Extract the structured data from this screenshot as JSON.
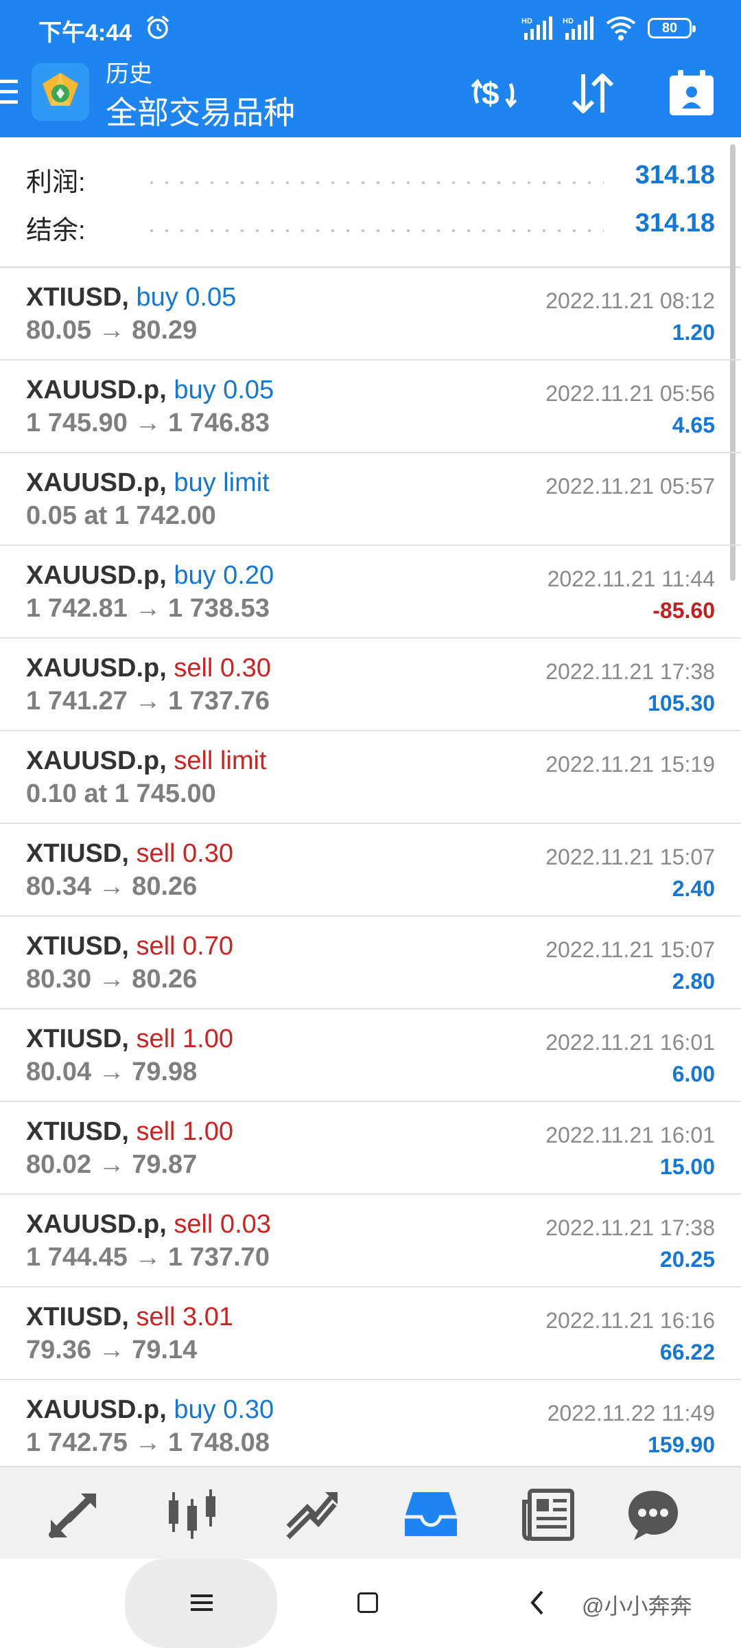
{
  "status_bar": {
    "time": "下午4:44",
    "net1": "HD",
    "net2": "HD",
    "battery": "80"
  },
  "header": {
    "subtitle": "历史",
    "title": "全部交易品种",
    "icons": [
      "menu-icon",
      "app-logo-icon",
      "currency-exchange-icon",
      "sort-icon",
      "calendar-icon"
    ],
    "color": "#1e84ef"
  },
  "summary": {
    "profit_label": "利润:",
    "profit_value": "314.18",
    "balance_label": "结余:",
    "balance_value": "314.18"
  },
  "orders": [
    {
      "symbol": "XTIUSD,",
      "side": "buy 0.05",
      "dir": "buy",
      "prices": "80.05 → 80.29",
      "time": "2022.11.21 08:12",
      "profit": "1.20"
    },
    {
      "symbol": "XAUUSD.p,",
      "side": "buy 0.05",
      "dir": "buy",
      "prices": "1 745.90 → 1 746.83",
      "time": "2022.11.21 05:56",
      "profit": "4.65"
    },
    {
      "symbol": "XAUUSD.p,",
      "side": "buy limit",
      "dir": "buy",
      "prices": "0.05 at 1 742.00",
      "time": "2022.11.21 05:57",
      "profit": ""
    },
    {
      "symbol": "XAUUSD.p,",
      "side": "buy 0.20",
      "dir": "buy",
      "prices": "1 742.81 → 1 738.53",
      "time": "2022.11.21 11:44",
      "profit": "-85.60"
    },
    {
      "symbol": "XAUUSD.p,",
      "side": "sell 0.30",
      "dir": "sell",
      "prices": "1 741.27 → 1 737.76",
      "time": "2022.11.21 17:38",
      "profit": "105.30"
    },
    {
      "symbol": "XAUUSD.p,",
      "side": "sell limit",
      "dir": "sell",
      "prices": "0.10 at 1 745.00",
      "time": "2022.11.21 15:19",
      "profit": ""
    },
    {
      "symbol": "XTIUSD,",
      "side": "sell 0.30",
      "dir": "sell",
      "prices": "80.34 → 80.26",
      "time": "2022.11.21 15:07",
      "profit": "2.40"
    },
    {
      "symbol": "XTIUSD,",
      "side": "sell 0.70",
      "dir": "sell",
      "prices": "80.30 → 80.26",
      "time": "2022.11.21 15:07",
      "profit": "2.80"
    },
    {
      "symbol": "XTIUSD,",
      "side": "sell 1.00",
      "dir": "sell",
      "prices": "80.04 → 79.98",
      "time": "2022.11.21 16:01",
      "profit": "6.00"
    },
    {
      "symbol": "XTIUSD,",
      "side": "sell 1.00",
      "dir": "sell",
      "prices": "80.02 → 79.87",
      "time": "2022.11.21 16:01",
      "profit": "15.00"
    },
    {
      "symbol": "XAUUSD.p,",
      "side": "sell 0.03",
      "dir": "sell",
      "prices": "1 744.45 → 1 737.70",
      "time": "2022.11.21 17:38",
      "profit": "20.25"
    },
    {
      "symbol": "XTIUSD,",
      "side": "sell 3.01",
      "dir": "sell",
      "prices": "79.36 → 79.14",
      "time": "2022.11.21 16:16",
      "profit": "66.22"
    },
    {
      "symbol": "XAUUSD.p,",
      "side": "buy 0.30",
      "dir": "buy",
      "prices": "1 742.75 → 1 748.08",
      "time": "2022.11.22 11:49",
      "profit": "159.90"
    }
  ],
  "tabbar": {
    "tabs": [
      "quotes-icon",
      "chart-icon",
      "trade-icon",
      "history-icon",
      "news-icon",
      "chat-icon"
    ],
    "active": "history-icon",
    "active_color": "#1e84ef",
    "inactive_color": "#555555"
  },
  "system_nav": {
    "watermark": "@小小奔奔"
  },
  "colors": {
    "buy": "#1477d6",
    "sell": "#cc2222",
    "loss": "#c22020"
  }
}
